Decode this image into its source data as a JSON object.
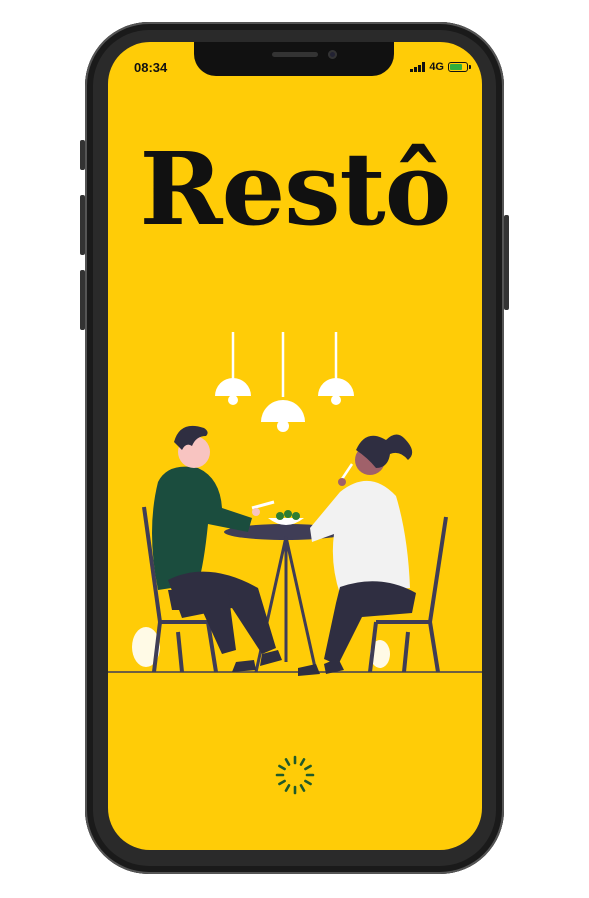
{
  "status_bar": {
    "time": "08:34",
    "network": "4G",
    "battery_level": 0.75,
    "signal_bars": 4
  },
  "app": {
    "logo_text": "Restô"
  },
  "colors": {
    "background": "#FFCC07",
    "ink": "#111111",
    "spinner": "#1f5a2a",
    "battery": "#2fae3a"
  },
  "illustration": {
    "description_icon": "couple-dining-illustration"
  },
  "loader": {
    "icon": "loading-spinner-icon"
  }
}
